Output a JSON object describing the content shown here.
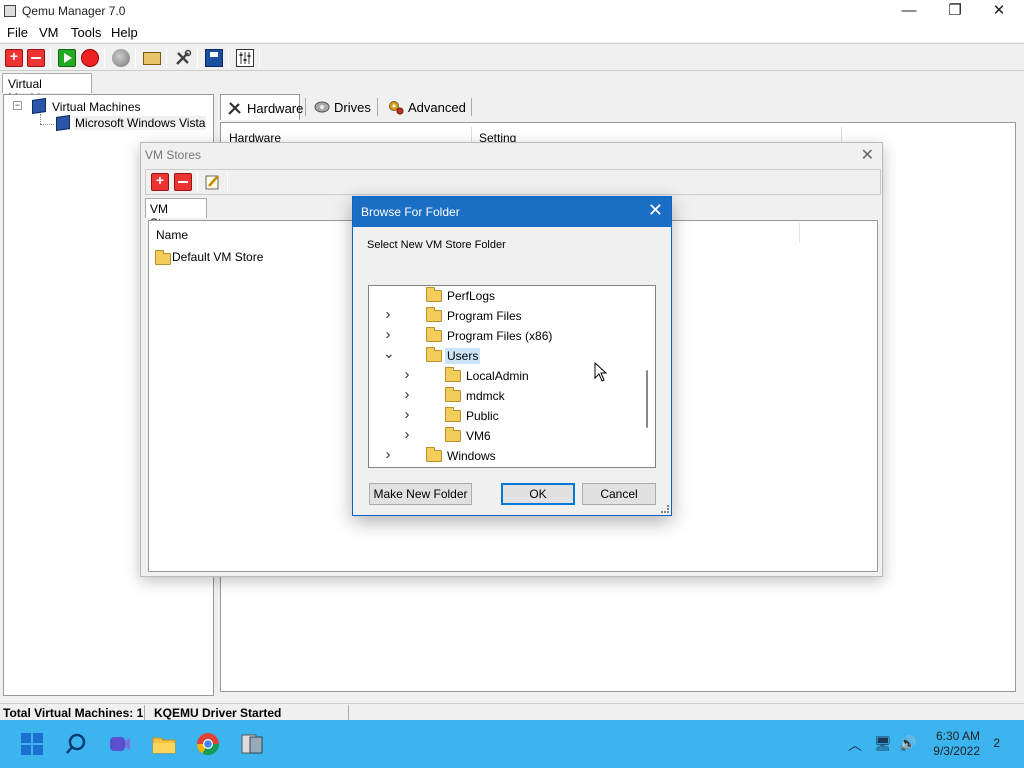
{
  "main_window": {
    "title": "Qemu Manager 7.0",
    "menu": [
      "File",
      "VM",
      "Tools",
      "Help"
    ],
    "left_tab": "Virtual Machines",
    "tree_root": "Virtual Machines",
    "tree_child": "Microsoft Windows Vista",
    "tabs": [
      "Hardware",
      "Drives",
      "Advanced"
    ],
    "columns": [
      "Hardware",
      "Setting"
    ],
    "status": [
      "Total Virtual Machines: 1",
      "KQEMU Driver Started"
    ]
  },
  "vm_stores": {
    "title": "VM Stores",
    "tab": "VM Stores",
    "column": "Name",
    "items": [
      "Default VM Store"
    ]
  },
  "browse_dialog": {
    "title": "Browse For Folder",
    "description": "Select New VM Store Folder",
    "folders": [
      {
        "label": "PerfLogs",
        "level": 0,
        "expander": "none",
        "selected": false
      },
      {
        "label": "Program Files",
        "level": 0,
        "expander": "collapsed",
        "selected": false
      },
      {
        "label": "Program Files (x86)",
        "level": 0,
        "expander": "collapsed",
        "selected": false
      },
      {
        "label": "Users",
        "level": 0,
        "expander": "expanded",
        "selected": true
      },
      {
        "label": "LocalAdmin",
        "level": 1,
        "expander": "collapsed",
        "selected": false
      },
      {
        "label": "mdmck",
        "level": 1,
        "expander": "collapsed",
        "selected": false
      },
      {
        "label": "Public",
        "level": 1,
        "expander": "collapsed",
        "selected": false
      },
      {
        "label": "VM6",
        "level": 1,
        "expander": "collapsed",
        "selected": false
      },
      {
        "label": "Windows",
        "level": 0,
        "expander": "collapsed",
        "selected": false
      }
    ],
    "buttons": {
      "make_new_folder": "Make New Folder",
      "ok": "OK",
      "cancel": "Cancel"
    }
  },
  "taskbar": {
    "apps": [
      "start-icon",
      "search-icon",
      "chat-icon",
      "file-explorer-icon",
      "chrome-icon",
      "qemu-manager-icon"
    ],
    "time": "6:30 AM",
    "date": "9/3/2022",
    "notification_count": "2"
  },
  "colors": {
    "dialog_title": "#1a6ec4",
    "taskbar": "#3bb4f0",
    "selection": "#cce4f7"
  }
}
